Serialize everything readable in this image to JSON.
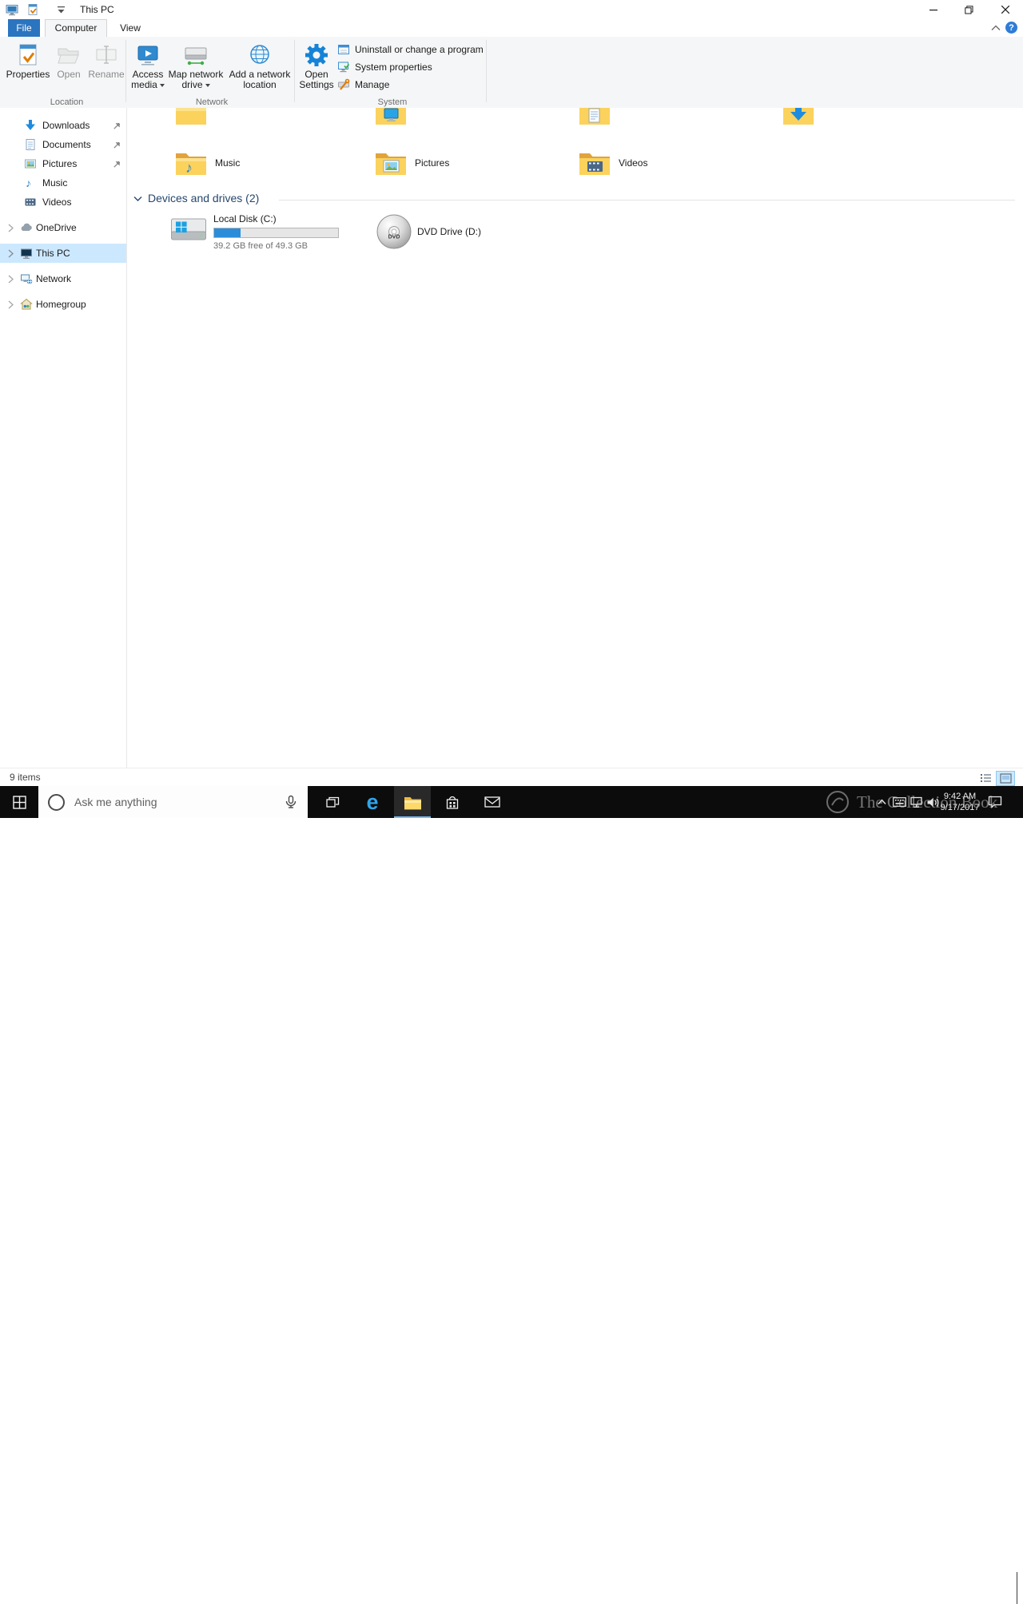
{
  "titlebar": {
    "title": "This PC"
  },
  "ribbon": {
    "tabs": {
      "file": "File",
      "computer": "Computer",
      "view": "View"
    },
    "location": {
      "label": "Location",
      "properties": "Properties",
      "open": "Open",
      "rename": "Rename"
    },
    "network": {
      "label": "Network",
      "access_line1": "Access",
      "access_line2": "media",
      "map_line1": "Map network",
      "map_line2": "drive",
      "add_line1": "Add a network",
      "add_line2": "location"
    },
    "system": {
      "label": "System",
      "settings_line1": "Open",
      "settings_line2": "Settings",
      "uninstall": "Uninstall or change a program",
      "sys_props": "System properties",
      "manage": "Manage"
    }
  },
  "sidebar": {
    "items": [
      {
        "label": "Downloads",
        "pinned": true
      },
      {
        "label": "Documents",
        "pinned": true
      },
      {
        "label": "Pictures",
        "pinned": true
      },
      {
        "label": "Music",
        "pinned": false
      },
      {
        "label": "Videos",
        "pinned": false
      },
      {
        "label": "OneDrive"
      },
      {
        "label": "This PC",
        "selected": true
      },
      {
        "label": "Network"
      },
      {
        "label": "Homegroup"
      }
    ]
  },
  "content": {
    "partial_folder_icons": [
      "folder",
      "desktop-folder",
      "documents-folder",
      "downloads-folder"
    ],
    "folders": [
      {
        "label": "Music"
      },
      {
        "label": "Pictures"
      },
      {
        "label": "Videos"
      }
    ],
    "devices_header": "Devices and drives (2)",
    "local_disk": {
      "label": "Local Disk (C:)",
      "free_text": "39.2 GB free of 49.3 GB",
      "used_percent": 21
    },
    "dvd": {
      "label": "DVD Drive (D:)"
    },
    "dvd_icon_text": "DVD"
  },
  "statusbar": {
    "items_count": "9 items"
  },
  "taskbar": {
    "search_placeholder": "Ask me anything",
    "time": "9:42 AM",
    "date": "9/17/2017",
    "watermark": "The Collection Book"
  }
}
